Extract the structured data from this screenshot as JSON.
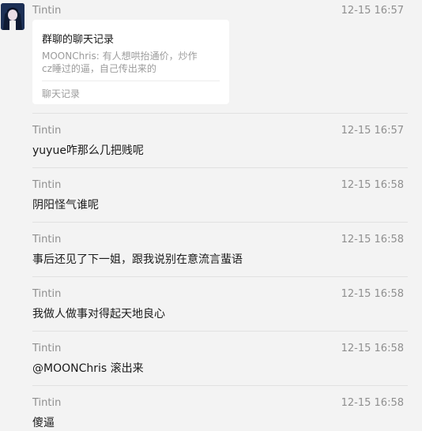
{
  "first_message": {
    "sender": "Tintin",
    "time": "12-15 16:57",
    "card": {
      "title": "群聊的聊天记录",
      "preview_line1": "MOONChris: 有人想哄抬通价，炒作",
      "preview_line2": "cz睡过的逼，自己传出来的",
      "footer": "聊天记录"
    }
  },
  "messages": [
    {
      "sender": "Tintin",
      "time": "12-15 16:57",
      "text": "yuyue咋那么几把贱呢"
    },
    {
      "sender": "Tintin",
      "time": "12-15 16:58",
      "text": "阴阳怪气谁呢"
    },
    {
      "sender": "Tintin",
      "time": "12-15 16:58",
      "text": "事后还见了下一姐，跟我说别在意流言蜚语"
    },
    {
      "sender": "Tintin",
      "time": "12-15 16:58",
      "text": "我做人做事对得起天地良心"
    },
    {
      "sender": "Tintin",
      "time": "12-15 16:58",
      "text": "@MOONChris 滚出来"
    },
    {
      "sender": "Tintin",
      "time": "12-15 16:58",
      "text": "傻逼"
    }
  ],
  "colors": {
    "background": "#f3f3f3",
    "card": "#ffffff",
    "meta_text": "#8f8f8f",
    "message_text": "#1a1a1a"
  }
}
